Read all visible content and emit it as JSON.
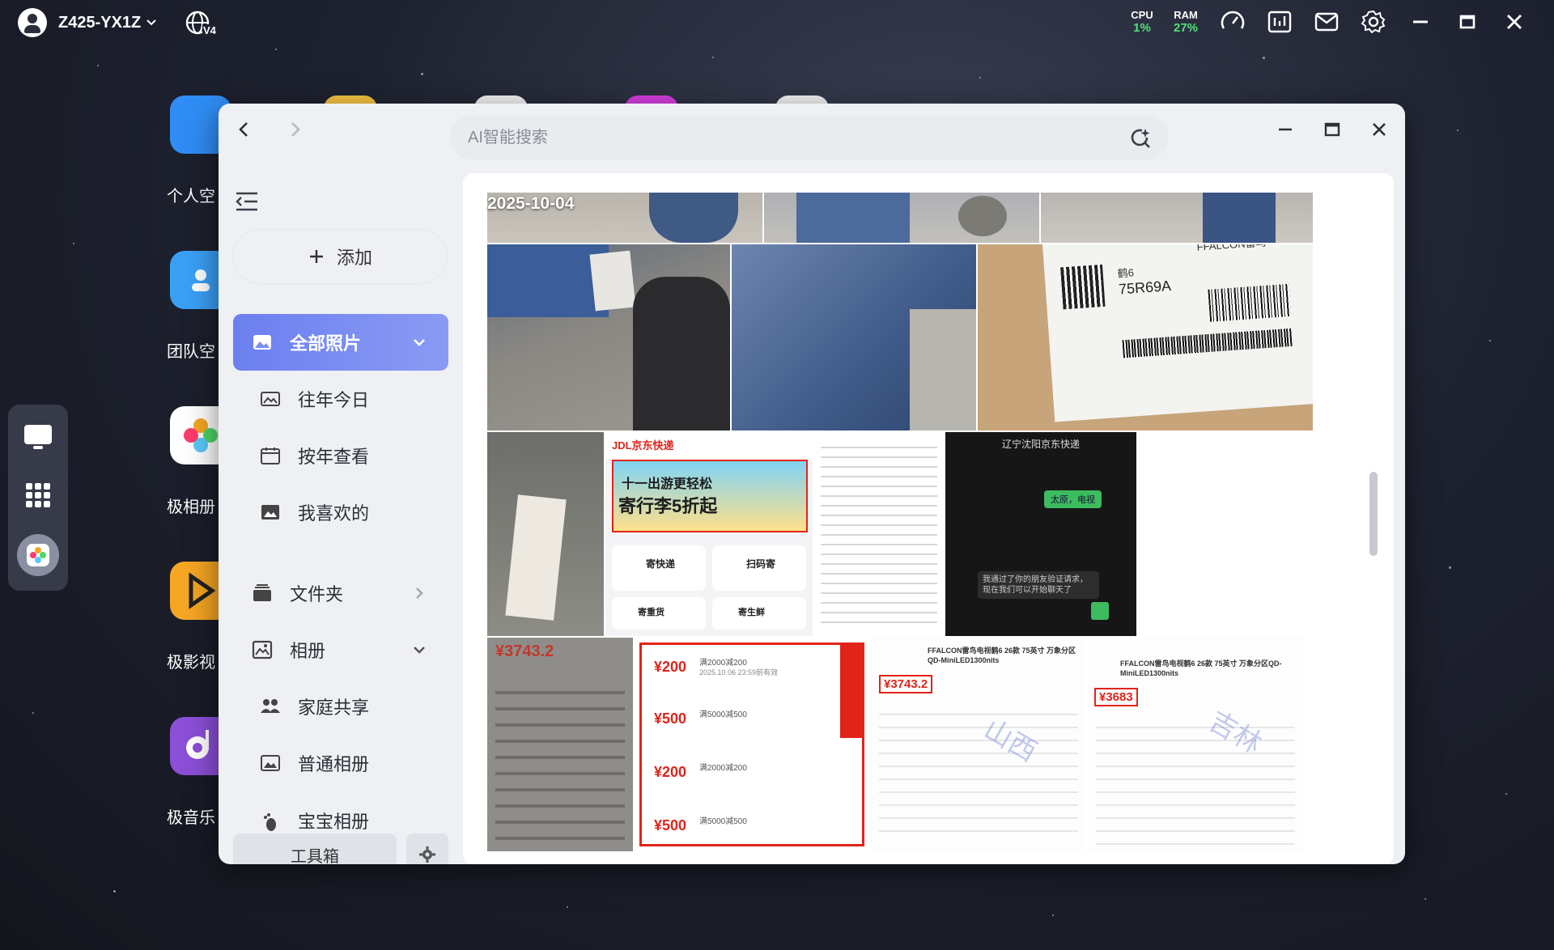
{
  "topbar": {
    "device_name": "Z425-YX1Z",
    "network_badge": "V4",
    "cpu_label": "CPU",
    "cpu_value": "1%",
    "ram_label": "RAM",
    "ram_value": "27%",
    "icons": [
      "user-avatar-icon",
      "globe-network-icon",
      "gauge-icon",
      "monitor-chart-icon",
      "mail-icon",
      "settings-gear-icon",
      "minimize-icon",
      "maximize-icon",
      "close-icon"
    ]
  },
  "desktop_apps": [
    {
      "label": "个人空",
      "icon": "folder-icon",
      "color": "#2f8df5"
    },
    {
      "label": "团队空",
      "icon": "team-folder-icon",
      "color": "#3aa0f6"
    },
    {
      "label": "极相册",
      "icon": "photos-icon",
      "color": "#ffffff"
    },
    {
      "label": "极影视",
      "icon": "video-icon",
      "color": "#f5a623"
    },
    {
      "label": "极音乐",
      "icon": "music-icon",
      "color": "#8c4fd8"
    }
  ],
  "window": {
    "search_placeholder": "AI智能搜索",
    "sidebar": {
      "add_label": "添加",
      "all_photos": "全部照片",
      "on_this_day": "往年今日",
      "by_year": "按年查看",
      "favorites": "我喜欢的",
      "folders": "文件夹",
      "albums": "相册",
      "family_share": "家庭共享",
      "normal_album": "普通相册",
      "baby_album": "宝宝相册",
      "toolbox": "工具箱"
    },
    "content": {
      "date_group": "2025-10-04",
      "thumb_texts": {
        "label_brand": "FFALCON雷鸟",
        "label_model": "75R69A",
        "label_size": "鹤6",
        "jd_banner_line1": "十一出游更轻松",
        "jd_banner_line2": "寄行李5折起",
        "jd_logo": "JDL京东快递",
        "jd_send": "寄快递",
        "jd_scan": "扫码寄",
        "jd_heavy": "寄重货",
        "jd_fresh": "寄生鲜",
        "chat_title": "辽宁沈阳京东快递",
        "chat_msg1": "太原，电视",
        "chat_msg2": "我通过了你的朋友验证请求，现在我们可以开始聊天了",
        "price_a": "¥3743.2",
        "price_b": "¥3743.2",
        "price_c": "¥3683",
        "coupon_200": "¥200",
        "coupon_500": "¥500",
        "coupon_rule_200": "满2000减200",
        "coupon_rule_500": "满5000减500",
        "coupon_date": "2025.10.06 23:59前有效",
        "watermark_1": "山西",
        "watermark_2": "吉林",
        "product_title": "FFALCON雷鸟电视鹤6 26款 75英寸 万象分区QD-MiniLED1300nits"
      }
    }
  }
}
